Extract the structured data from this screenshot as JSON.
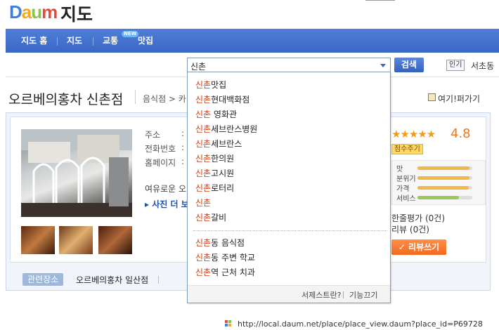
{
  "header": {
    "logo": [
      "D",
      "a",
      "u",
      "m"
    ],
    "logo_text": "daum",
    "map_title": "지도"
  },
  "nav": {
    "items": [
      "지도 홈",
      "지도",
      "교통",
      "맛집"
    ],
    "new_badge": "NEW"
  },
  "search": {
    "query": "신촌",
    "button": "검색",
    "popular_badge": "인기",
    "popular_word": "서초동"
  },
  "place": {
    "title": "오르베의홍차 신촌점",
    "category": "음식점 > 카",
    "share": "여기!퍼가기",
    "labels": [
      "주소",
      "전화번호",
      "홈페이지"
    ],
    "colons": [
      ":",
      ":",
      ":"
    ],
    "description": "여유로운 오",
    "more_photos": "▸ 사진 더 보"
  },
  "rating": {
    "stars": "★★★★★",
    "score": "4.8",
    "score_button": "점수주기",
    "criteria": [
      {
        "label": "맛",
        "level": 0.95
      },
      {
        "label": "분위기",
        "level": 0.95
      },
      {
        "label": "가격",
        "level": 0.93
      },
      {
        "label": "서비스",
        "level": 0.75
      }
    ],
    "review_one_line": "한줄평가 (0건)",
    "review": "리뷰 (0건)",
    "write_button": "✓ 리뷰쓰기"
  },
  "related": {
    "tag": "관련장소",
    "item": "오르베의홍차 일산점"
  },
  "suggestions": {
    "group1": [
      {
        "hl": "신촌",
        "rest": "맛집"
      },
      {
        "hl": "신촌",
        "rest": "현대백화점"
      },
      {
        "hl": "신촌",
        "rest": " 영화관"
      },
      {
        "hl": "신촌",
        "rest": "세브란스병원"
      },
      {
        "hl": "신촌",
        "rest": "세브란스"
      },
      {
        "hl": "신촌",
        "rest": "한의원"
      },
      {
        "hl": "신촌",
        "rest": "고시원"
      },
      {
        "hl": "신촌",
        "rest": "로터리"
      },
      {
        "hl": "신촌",
        "rest": ""
      },
      {
        "hl": "신촌",
        "rest": "갈비"
      }
    ],
    "group2": [
      {
        "hl": "신촌",
        "rest": "동 음식점"
      },
      {
        "hl": "신촌",
        "rest": "동 주변 학교"
      },
      {
        "hl": "신촌",
        "rest": "역 근처 치과"
      }
    ],
    "footer_left": "서제스트란?",
    "footer_right": "기능끄기"
  },
  "status_bar": {
    "url": "http://local.daum.net/place/place_view.daum?place_id=P69728"
  },
  "colors": {
    "nav": "#3a67c4",
    "highlight": "#d4380d",
    "score": "#e8781f",
    "write_button": "#f26a1e"
  }
}
